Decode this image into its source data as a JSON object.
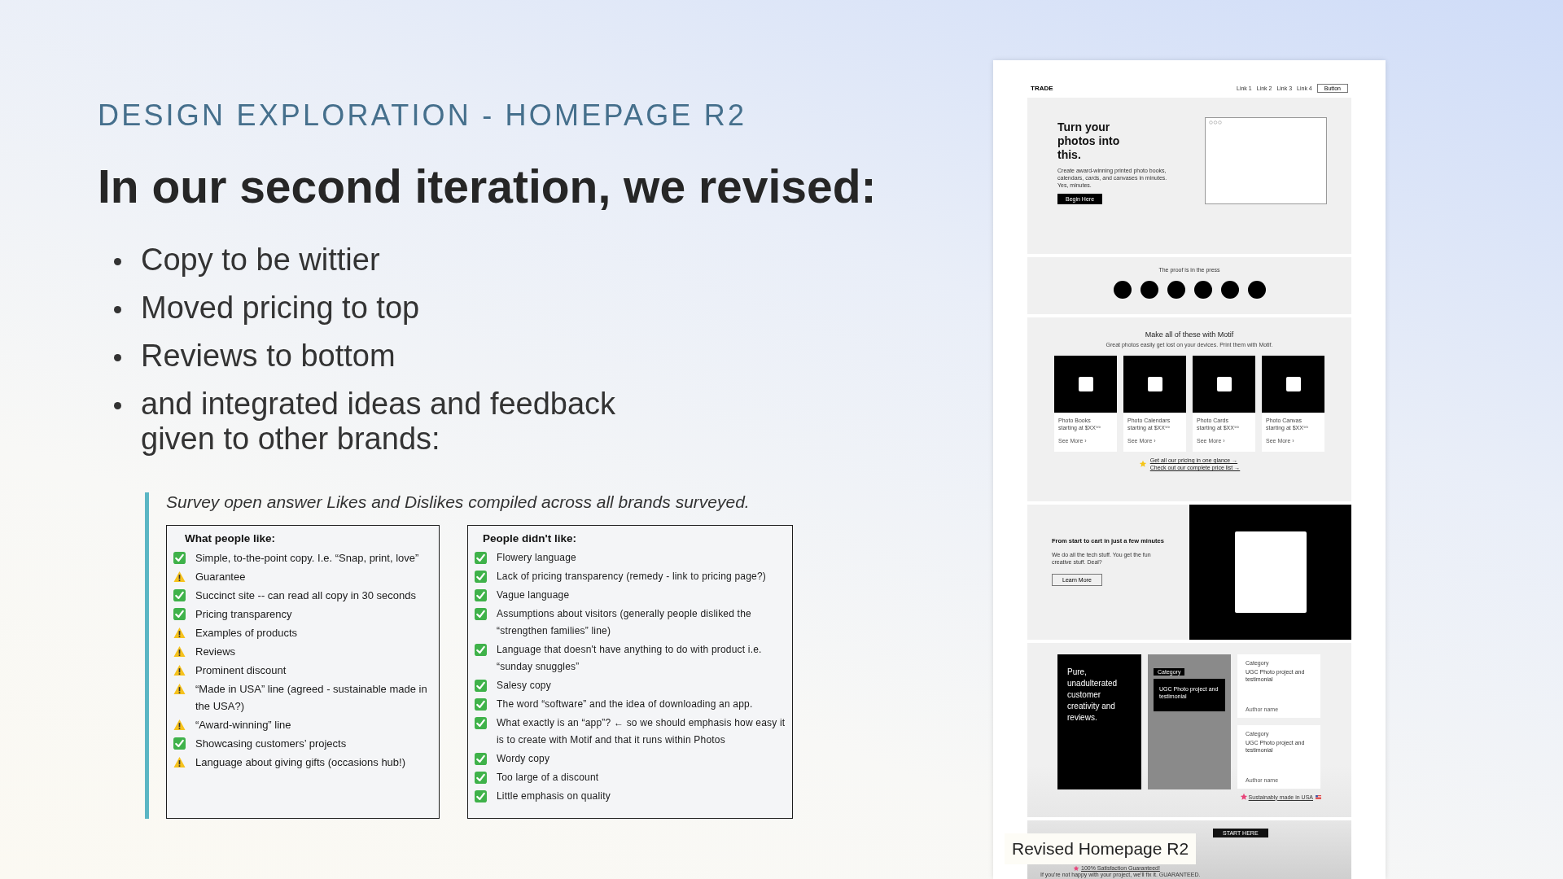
{
  "eyebrow": "DESIGN EXPLORATION - HOMEPAGE R2",
  "heading": "In our second iteration, we revised:",
  "bullets": [
    "Copy to be wittier",
    "Moved pricing to top",
    "Reviews to bottom",
    "and integrated ideas and feedback given to other brands:"
  ],
  "survey": {
    "caption": "Survey open answer Likes and Dislikes compiled across all brands surveyed.",
    "panels": [
      {
        "title": "What people like:",
        "items": [
          {
            "kind": "check",
            "text": "Simple, to-the-point copy. I.e. “Snap, print, love”"
          },
          {
            "kind": "warning",
            "text": "Guarantee"
          },
          {
            "kind": "check",
            "text": "Succinct site -- can read all copy in 30 seconds"
          },
          {
            "kind": "check",
            "text": "Pricing transparency"
          },
          {
            "kind": "warning",
            "text": "Examples of products"
          },
          {
            "kind": "warning",
            "text": "Reviews"
          },
          {
            "kind": "warning",
            "text": "Prominent discount"
          },
          {
            "kind": "warning",
            "text": "“Made in USA” line (agreed - sustainable made in the USA?)"
          },
          {
            "kind": "warning",
            "text": "“Award-winning” line"
          },
          {
            "kind": "check",
            "text": "Showcasing customers’ projects"
          },
          {
            "kind": "warning",
            "text": "Language about giving gifts (occasions hub!)"
          }
        ]
      },
      {
        "title": "People didn't like:",
        "items": [
          {
            "kind": "check",
            "text": "Flowery language"
          },
          {
            "kind": "check",
            "text": "Lack of pricing transparency (remedy - link to pricing page?)"
          },
          {
            "kind": "check",
            "text": "Vague language"
          },
          {
            "kind": "check",
            "text": "Assumptions about visitors (generally people disliked the “strengthen families” line)"
          },
          {
            "kind": "check",
            "text": "Language that doesn't have anything to do with product i.e. “sunday snuggles”"
          },
          {
            "kind": "check",
            "text": "Salesy copy"
          },
          {
            "kind": "check",
            "text": "The word “software” and the idea of downloading an app."
          },
          {
            "kind": "check",
            "text": "What exactly is an “app”? ← so we should emphasis how easy it is to create with Motif and that it runs within Photos"
          },
          {
            "kind": "check",
            "text": "Wordy copy"
          },
          {
            "kind": "check",
            "text": "Too large of a discount"
          },
          {
            "kind": "check",
            "text": "Little emphasis on quality"
          }
        ]
      }
    ]
  },
  "mockup": {
    "logo": "TRADE",
    "nav_links": [
      "Link 1",
      "Link 2",
      "Link 3",
      "Link 4"
    ],
    "nav_button": "Button",
    "hero": {
      "title": "Turn your photos into this.",
      "body": "Create award-winning printed photo books, calendars, cards, and canvases in minutes. Yes, minutes.",
      "button": "Begin Here"
    },
    "press": {
      "title": "The proof is in the press"
    },
    "products": {
      "title": "Make all of these with Motif",
      "subtitle": "Great photos easily get lost on your devices. Print them with Motif.",
      "cards": [
        {
          "name": "Photo Books",
          "price": "starting at $XX⁹⁹",
          "link": "See More ›"
        },
        {
          "name": "Photo Calendars",
          "price": "starting at $XX⁹⁹",
          "link": "See More ›"
        },
        {
          "name": "Photo Cards",
          "price": "starting at $XX⁹⁹",
          "link": "See More ›"
        },
        {
          "name": "Photo Canvas",
          "price": "starting at $XX⁹⁹",
          "link": "See More ›"
        }
      ],
      "links": [
        "Get all our pricing in one glance →",
        "Check out our complete price list →"
      ]
    },
    "feature": {
      "title": "From start to cart in just a few minutes",
      "body": "We do all the tech stuff. You get the fun creative stuff. Deal?",
      "button": "Learn More"
    },
    "reviews": {
      "headline": "Pure, unadulterated customer creativity and reviews.",
      "featured": {
        "category": "Category",
        "text": "UGC Photo project and testimonial"
      },
      "cards": [
        {
          "category": "Category",
          "text": "UGC Photo project and testimonial",
          "author": "Author name"
        },
        {
          "category": "Category",
          "text": "UGC Photo project and testimonial",
          "author": "Author name"
        }
      ],
      "made_in_usa": "Sustainably made in USA"
    },
    "cta": {
      "button": "START HERE",
      "guarantee": "100% Satisfaction Guaranteed!",
      "note": "If you're not happy with your project, we'll fix it. GUARANTEED."
    },
    "caption": "Revised Homepage R2"
  }
}
